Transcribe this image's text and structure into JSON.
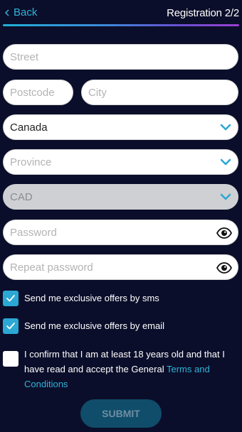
{
  "header": {
    "back_label": "Back",
    "title": "Registration 2/2"
  },
  "form": {
    "street": {
      "placeholder": "Street",
      "value": ""
    },
    "postcode": {
      "placeholder": "Postcode",
      "value": ""
    },
    "city": {
      "placeholder": "City",
      "value": ""
    },
    "country": {
      "value": "Canada"
    },
    "province": {
      "placeholder": "Province"
    },
    "currency": {
      "placeholder": "CAD"
    },
    "password": {
      "placeholder": "Password",
      "value": ""
    },
    "repeat_password": {
      "placeholder": "Repeat password",
      "value": ""
    }
  },
  "consents": {
    "sms": {
      "label": "Send me exclusive offers by sms",
      "checked": true
    },
    "email": {
      "label": "Send me exclusive offers by email",
      "checked": true
    },
    "age": {
      "label_prefix": "I confirm that I am at least 18 years old and that I have read and accept the General",
      "link_text": "Terms and Conditions",
      "checked": false
    }
  },
  "submit_label": "SUBMIT",
  "colors": {
    "background": "#0b0e2a",
    "accent": "#2fb3d8",
    "submit_bg": "#0f4d6a"
  }
}
